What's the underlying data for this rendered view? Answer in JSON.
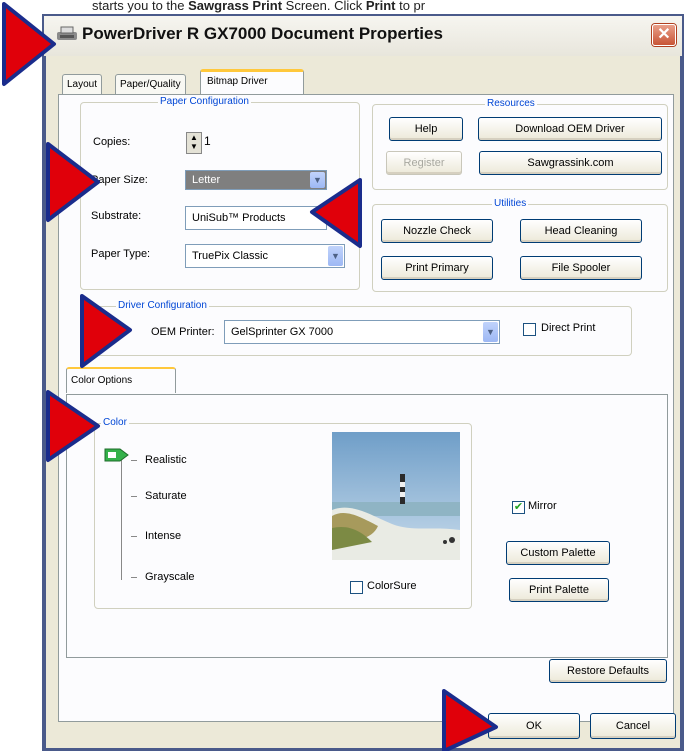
{
  "top_caption": {
    "pre": "starts you to the ",
    "bold1": "Sawgrass Print",
    "mid": " Screen. Click ",
    "bold2": "Print",
    "post": " to pr"
  },
  "window": {
    "title": "PowerDriver R GX7000 Document Properties",
    "close_glyph": "✕"
  },
  "tabs": [
    {
      "label": "Layout"
    },
    {
      "label": "Paper/Quality"
    },
    {
      "label": "Bitmap Driver"
    }
  ],
  "paper_config": {
    "title": "Paper Configuration",
    "copies_label": "Copies:",
    "copies_value": "1",
    "paper_size_label": "Paper Size:",
    "paper_size_value": "Letter",
    "substrate_label": "Substrate:",
    "substrate_value": "UniSub™ Products",
    "paper_type_label": "Paper Type:",
    "paper_type_value": "TruePix Classic"
  },
  "resources": {
    "title": "Resources",
    "help": "Help",
    "download": "Download OEM Driver",
    "register": "Register",
    "sawgrass": "Sawgrassink.com"
  },
  "utilities": {
    "title": "Utilities",
    "nozzle": "Nozzle Check",
    "head": "Head Cleaning",
    "primary": "Print Primary",
    "spooler": "File Spooler"
  },
  "driver_config": {
    "title": "Driver Configuration",
    "oem_label": "OEM Printer:",
    "oem_value": "GelSprinter GX 7000",
    "direct_print": "Direct Print"
  },
  "color_tab": {
    "label": "Color Options"
  },
  "color": {
    "title": "Color",
    "options": [
      "Realistic",
      "Saturate",
      "Intense",
      "Grayscale"
    ],
    "selected": "Realistic",
    "colorsure": "ColorSure",
    "mirror": "Mirror",
    "mirror_checked": true,
    "custom_palette": "Custom Palette",
    "print_palette": "Print Palette"
  },
  "buttons": {
    "restore": "Restore Defaults",
    "ok": "OK",
    "cancel": "Cancel"
  },
  "colors": {
    "arrow": "#e0000a",
    "arrow_outline": "#1a2c8c",
    "titlebar": "#ece9d8",
    "group_label": "#0046d5"
  }
}
